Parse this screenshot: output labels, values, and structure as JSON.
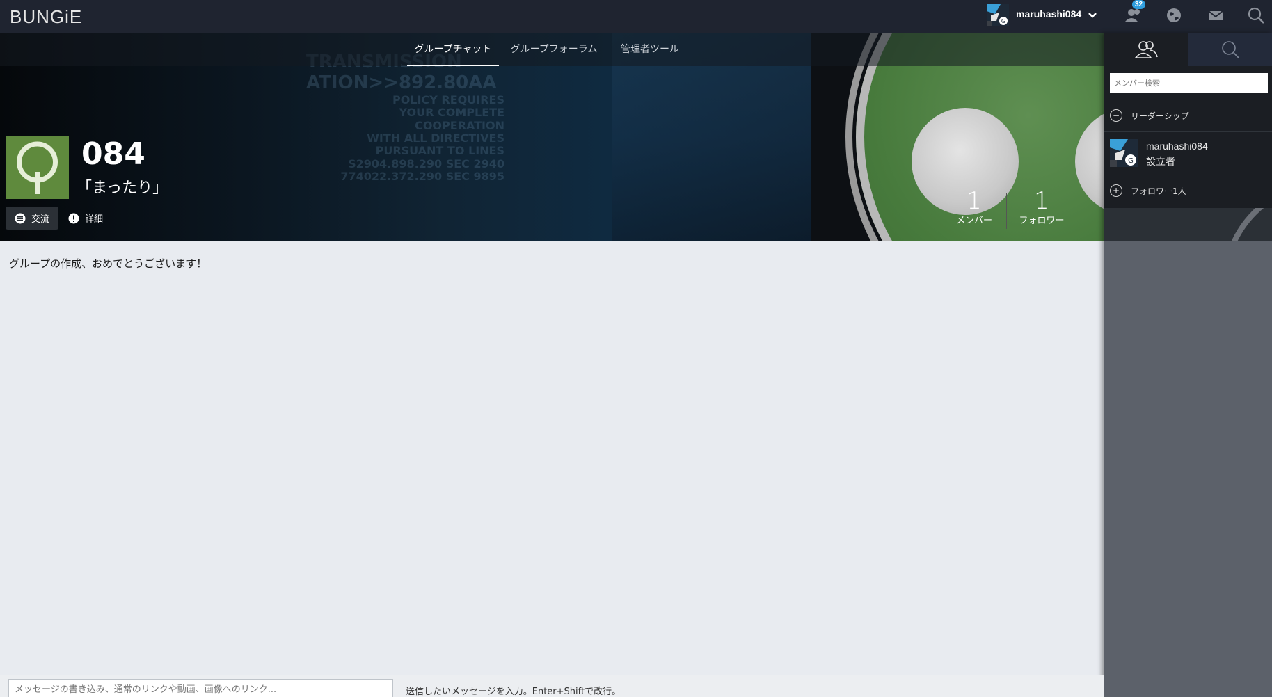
{
  "topbar": {
    "logo": "BUNGiE",
    "username": "maruhashi084",
    "notification_count": "32"
  },
  "hero": {
    "terminal_line1": "TRANSMISSION",
    "terminal_line2": "ATION>>892.80AA",
    "terminal_lines": [
      "POLICY REQUIRES",
      "YOUR COMPLETE COOPERATION",
      "WITH ALL DIRECTIVES",
      "PURSUANT TO LINES",
      "S2904.898.290 SEC 2940",
      "774022.372.290 SEC 9895"
    ]
  },
  "tabs": [
    {
      "label": "グループチャット",
      "active": true
    },
    {
      "label": "グループフォーラム",
      "active": false
    },
    {
      "label": "管理者ツール",
      "active": false
    }
  ],
  "group": {
    "name": "084",
    "motto": "「まったり」",
    "exchange_label": "交流",
    "detail_label": "詳細",
    "member_count": "1",
    "member_label": "メンバー",
    "follower_count": "1",
    "follower_label": "フォロワー"
  },
  "sidebar": {
    "search_placeholder": "メンバー検索",
    "leadership_label": "リーダーシップ",
    "member": {
      "name": "maruhashi084",
      "role": "設立者"
    },
    "followers_label": "フォロワー1人"
  },
  "main": {
    "welcome_text": "グループの作成、おめでとうございます！"
  },
  "composer": {
    "placeholder": "メッセージの書き込み、通常のリンクや動画、画像へのリンク...",
    "hint": "送信したいメッセージを入力。Enter+Shiftで改行。"
  },
  "colors": {
    "topbar_bg": "#1f2430",
    "accent_badge": "#2f9ede",
    "emblem_green": "#5f8a3d",
    "main_bg": "#e8ebf0",
    "sidebar_bg": "#5c616a"
  }
}
